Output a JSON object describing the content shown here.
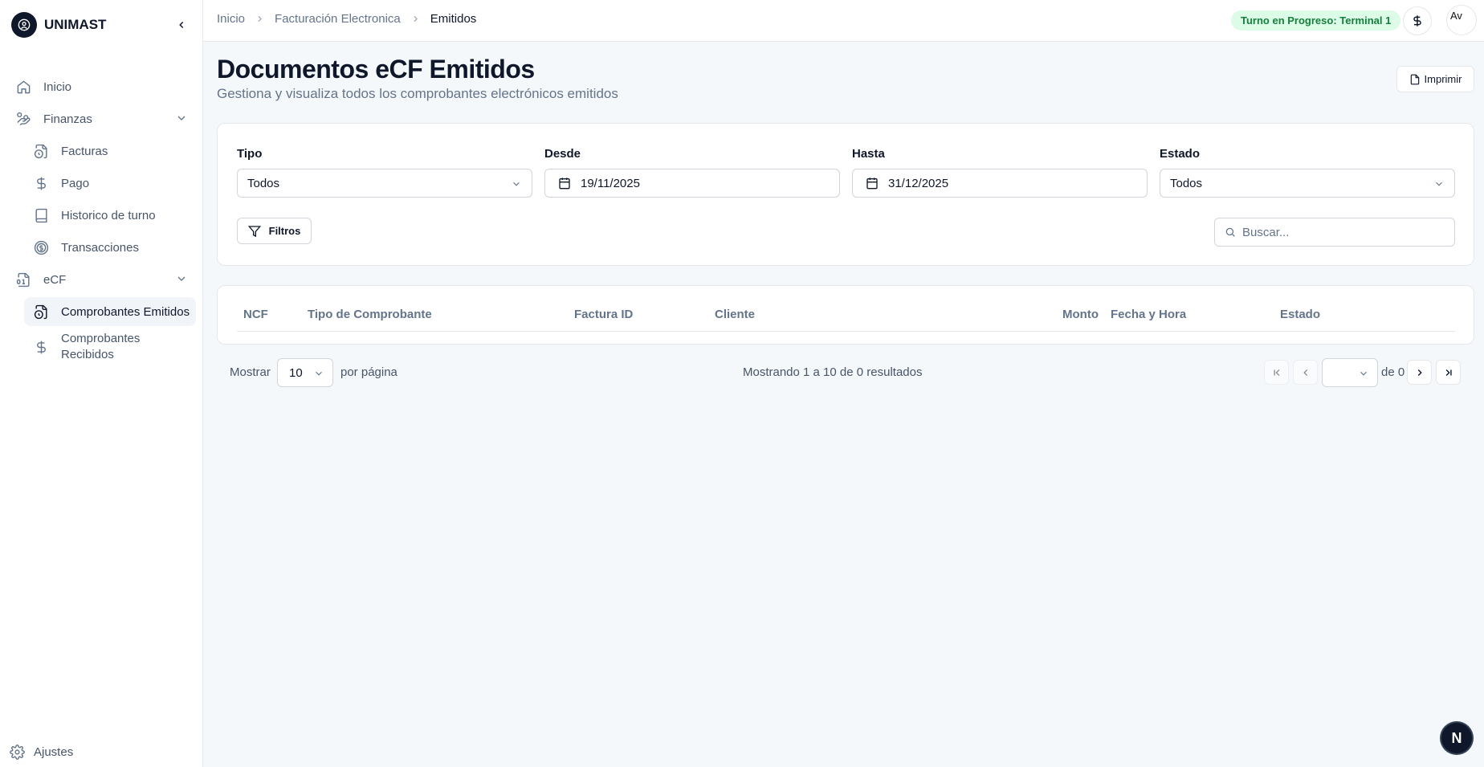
{
  "brand": {
    "name": "UNIMAST"
  },
  "sidebar": {
    "items": [
      {
        "label": "Inicio",
        "icon": "home-icon"
      },
      {
        "label": "Finanzas",
        "icon": "hand-coins-icon"
      },
      {
        "label": "Facturas",
        "icon": "file-clock-icon"
      },
      {
        "label": "Pago",
        "icon": "dollar-icon"
      },
      {
        "label": "Historico de turno",
        "icon": "book-icon"
      },
      {
        "label": "Transacciones",
        "icon": "circle-dollar-icon"
      },
      {
        "label": "eCF",
        "icon": "file-digit-icon"
      },
      {
        "label": "Comprobantes Emitidos",
        "icon": "file-clock-icon"
      },
      {
        "label": "Comprobantes Recibidos",
        "icon": "dollar-icon"
      }
    ],
    "settings_label": "Ajustes"
  },
  "topbar": {
    "breadcrumb": [
      "Inicio",
      "Facturación Electronica",
      "Emitidos"
    ],
    "shift_badge": "Turno en Progreso: Terminal 1",
    "avatar_alt": "Av"
  },
  "header": {
    "title": "Documentos eCF Emitidos",
    "subtitle": "Gestiona y visualiza todos los comprobantes electrónicos emitidos",
    "print_label": "Imprimir"
  },
  "filters": {
    "tipo": {
      "label": "Tipo",
      "value": "Todos"
    },
    "desde": {
      "label": "Desde",
      "value": "19/11/2025"
    },
    "hasta": {
      "label": "Hasta",
      "value": "31/12/2025"
    },
    "estado": {
      "label": "Estado",
      "value": "Todos"
    },
    "filters_button": "Filtros",
    "search_placeholder": "Buscar..."
  },
  "table": {
    "columns": [
      "NCF",
      "Tipo de Comprobante",
      "Factura ID",
      "Cliente",
      "Monto",
      "Fecha y Hora",
      "Estado"
    ],
    "rows": []
  },
  "pagination": {
    "show_label": "Mostrar",
    "per_page": "10",
    "per_page_label": "por página",
    "summary": "Mostrando 1 a 10 de 0 resultados",
    "of_label": "de 0"
  },
  "dev_badge": "N"
}
